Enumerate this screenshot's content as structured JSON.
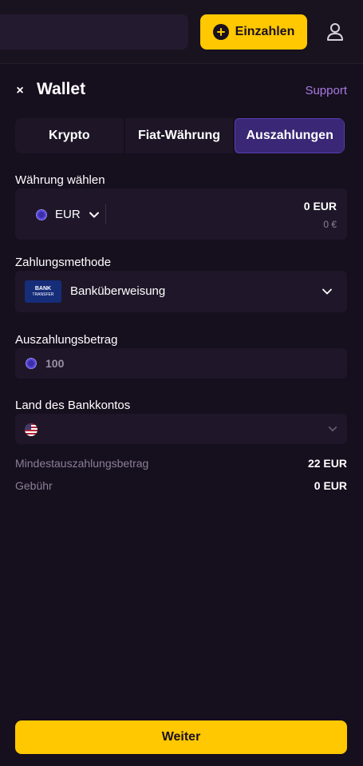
{
  "topbar": {
    "deposit_label": "Einzahlen"
  },
  "wallet": {
    "title": "Wallet",
    "close_icon": "×",
    "support_label": "Support"
  },
  "tabs": [
    {
      "label": "Krypto",
      "active": false
    },
    {
      "label": "Fiat-Währung",
      "active": false
    },
    {
      "label": "Auszahlungen",
      "active": true
    }
  ],
  "currency": {
    "label": "Währung wählen",
    "selected": "EUR",
    "amount": "0 EUR",
    "amount_sub": "0 €"
  },
  "payment_method": {
    "label": "Zahlungsmethode",
    "logo_line1": "BANK",
    "logo_line2": "TRANSFER",
    "selected": "Banküberweisung"
  },
  "withdraw_amount": {
    "label": "Auszahlungsbetrag",
    "value": "100"
  },
  "bank_country": {
    "label": "Land des Bankkontos"
  },
  "info": {
    "min_label": "Mindestauszahlungsbetrag",
    "min_value": "22 EUR",
    "fee_label": "Gebühr",
    "fee_value": "0 EUR"
  },
  "continue_label": "Weiter",
  "colors": {
    "accent": "#ffc800",
    "tab_active": "#3a2775",
    "support_link": "#a77be0",
    "background": "#160f1e"
  }
}
